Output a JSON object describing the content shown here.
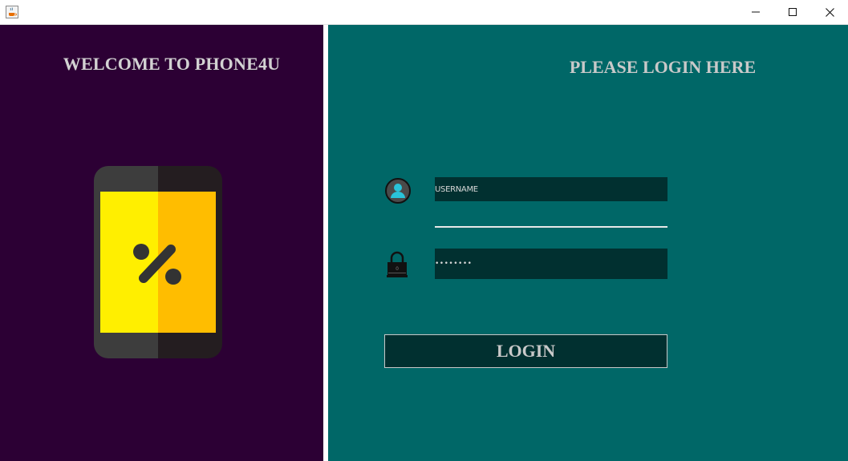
{
  "window": {
    "app_icon": "java-cup-icon",
    "controls": [
      "minimize-icon",
      "maximize-icon",
      "close-icon"
    ]
  },
  "left_panel": {
    "welcome_text": "WELCOME TO PHONE4U",
    "illustration": "phone-percent-icon",
    "background": "#2c0034"
  },
  "right_panel": {
    "title": "PLEASE LOGIN HERE",
    "background": "#006767",
    "username": {
      "icon": "user-icon",
      "value": "USERNAME"
    },
    "password": {
      "icon": "lock-icon",
      "value": "••••••••"
    },
    "login_button": {
      "label": "LOGIN"
    }
  }
}
